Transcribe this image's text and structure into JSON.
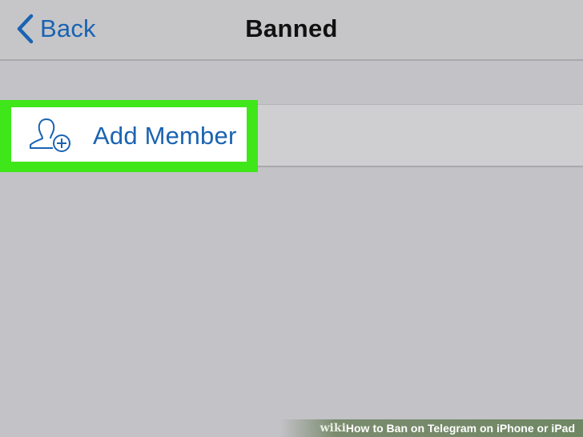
{
  "navbar": {
    "back_label": "Back",
    "title": "Banned",
    "back_icon": "chevron-left-icon"
  },
  "list": {
    "add_member_label": "Add Member",
    "add_member_icon": "add-user-icon"
  },
  "colors": {
    "accent": "#1a63b3",
    "highlight": "#3ee61a",
    "background": "#c3c2c7"
  },
  "watermark": {
    "wiki": "wiki",
    "how": "How",
    "text": "to Ban on Telegram on iPhone or iPad"
  }
}
